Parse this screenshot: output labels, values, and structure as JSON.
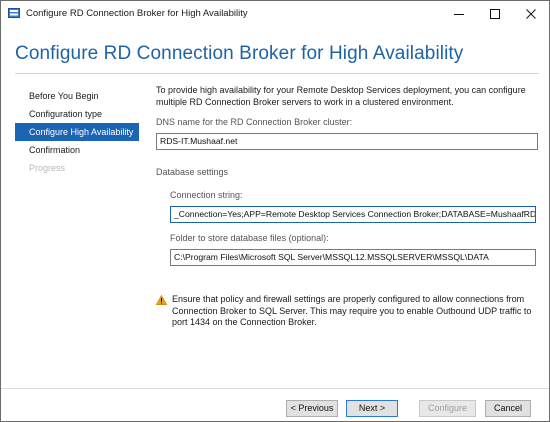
{
  "window": {
    "title": "Configure RD Connection Broker for High Availability",
    "controls": [
      "minimize-icon",
      "maximize-icon",
      "close-icon"
    ]
  },
  "page": {
    "heading": "Configure RD Connection Broker for High Availability"
  },
  "nav": {
    "items": [
      {
        "label": "Before You Begin",
        "state": "normal"
      },
      {
        "label": "Configuration type",
        "state": "normal"
      },
      {
        "label": "Configure High Availability",
        "state": "active"
      },
      {
        "label": "Confirmation",
        "state": "normal"
      },
      {
        "label": "Progress",
        "state": "disabled"
      }
    ]
  },
  "content": {
    "intro": "To provide high availability for your Remote Desktop Services deployment, you can configure multiple RD Connection Broker servers to work in a clustered environment.",
    "dns_label": "DNS name for the RD Connection Broker cluster:",
    "dns_value": "RDS-IT.Mushaaf.net",
    "db_section": "Database settings",
    "conn_label": "Connection string:",
    "conn_value": "_Connection=Yes;APP=Remote Desktop Services Connection Broker;DATABASE=MushaafRDCB",
    "folder_label": "Folder to store database files (optional):",
    "folder_value": "C:\\Program Files\\Microsoft SQL Server\\MSSQL12.MSSQLSERVER\\MSSQL\\DATA",
    "warning": "Ensure that policy and firewall settings are properly configured to allow connections from Connection Broker to SQL Server. This may require you to enable Outbound UDP traffic to port 1434 on the Connection Broker."
  },
  "buttons": {
    "previous": "< Previous",
    "next": "Next >",
    "configure": "Configure",
    "cancel": "Cancel"
  },
  "colors": {
    "accent": "#1c64b4",
    "heading": "#1e63a8",
    "warning": "#e8a317"
  }
}
